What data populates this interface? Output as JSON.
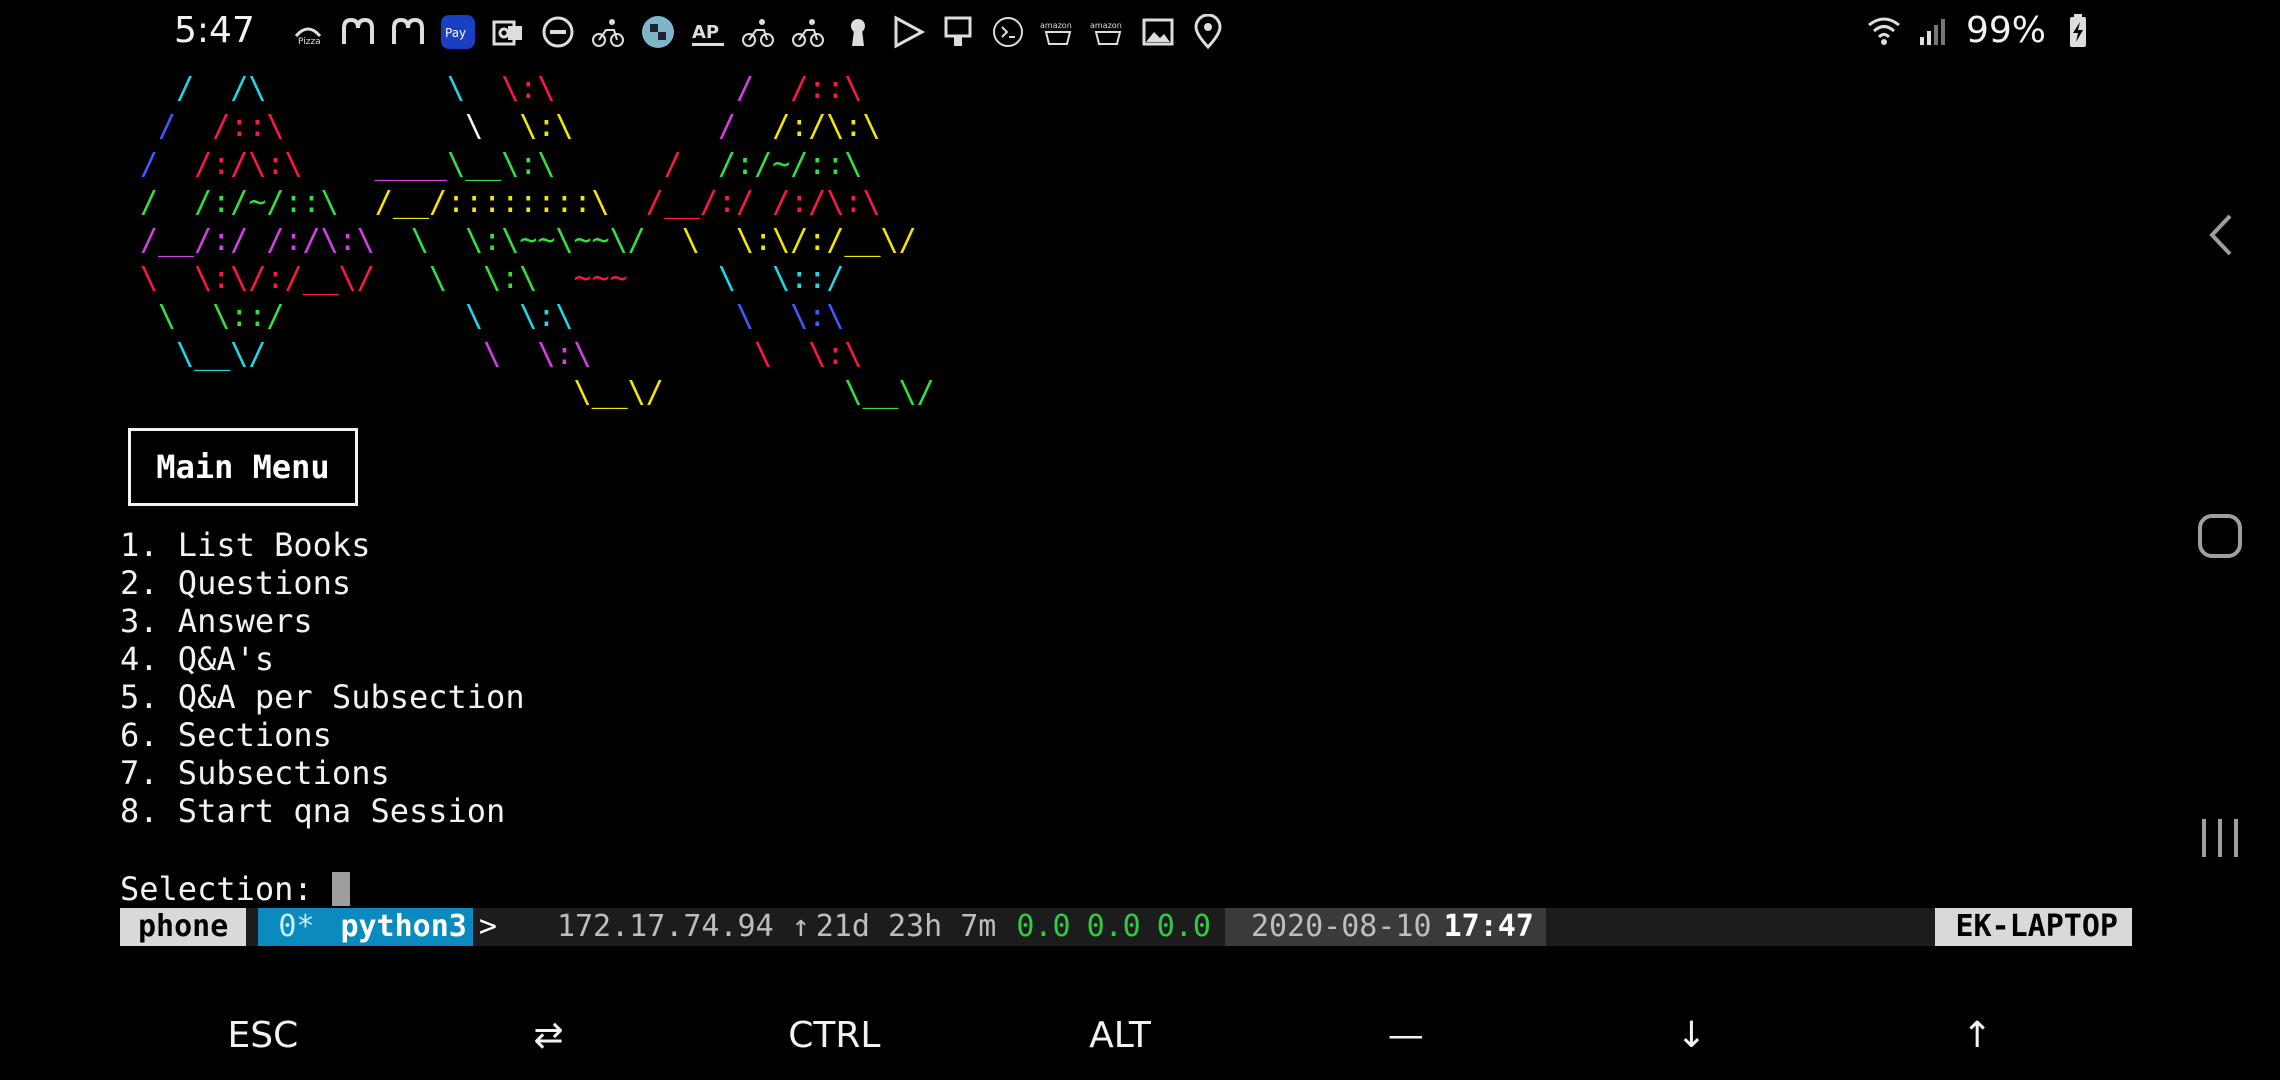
{
  "status_bar": {
    "time": "5:47",
    "icons": [
      "pizza-hut-icon",
      "mcdonalds-icon",
      "mcdonalds-icon",
      "samsung-pay-icon",
      "outlook-icon",
      "do-not-disturb-icon",
      "cycling-icon",
      "chess-icon",
      "ap-news-icon",
      "cycling-icon",
      "cycling-icon",
      "keyhole-icon",
      "play-store-icon",
      "transit-icon",
      "terminal-icon",
      "amazon-icon",
      "amazon-icon",
      "gallery-icon",
      "location-icon"
    ],
    "battery_percent": "99%"
  },
  "ascii_art": [
    [
      {
        "t": "  /  ",
        "c": "c"
      },
      {
        "t": "/\\",
        "c": "c"
      },
      {
        "t": "          \\  ",
        "c": "c"
      },
      {
        "t": "\\:\\",
        "c": "r"
      },
      {
        "t": "          /  ",
        "c": "m"
      },
      {
        "t": "/::\\",
        "c": "r"
      }
    ],
    [
      {
        "t": " /  ",
        "c": "b"
      },
      {
        "t": "/::\\",
        "c": "r"
      },
      {
        "t": "          \\  ",
        "c": "w"
      },
      {
        "t": "\\:\\",
        "c": "y"
      },
      {
        "t": "        /  ",
        "c": "m"
      },
      {
        "t": "/:/\\:\\",
        "c": "y"
      }
    ],
    [
      {
        "t": "/  ",
        "c": "b"
      },
      {
        "t": "/:/\\:\\",
        "c": "r"
      },
      {
        "t": "    ____",
        "c": "m"
      },
      {
        "t": "\\__\\:\\",
        "c": "g"
      },
      {
        "t": "      /  ",
        "c": "r"
      },
      {
        "t": "/:/~/::\\",
        "c": "g"
      }
    ],
    [
      {
        "t": "/  /:/~/::\\",
        "c": "g"
      },
      {
        "t": "  /__/::::::::\\",
        "c": "y"
      },
      {
        "t": "  /__/:/ /:/\\:\\",
        "c": "r"
      }
    ],
    [
      {
        "t": "/__/:/ /:/\\:\\",
        "c": "m"
      },
      {
        "t": "  \\  \\:\\~~\\~~\\/",
        "c": "g"
      },
      {
        "t": "  \\  \\:\\/:/__\\/",
        "c": "y"
      }
    ],
    [
      {
        "t": "\\  \\:\\/:/__\\/",
        "c": "r"
      },
      {
        "t": "   \\  \\:\\  ",
        "c": "g"
      },
      {
        "t": "~~~",
        "c": "r"
      },
      {
        "t": "     \\  \\::/",
        "c": "c"
      }
    ],
    [
      {
        "t": " \\  \\::/",
        "c": "g"
      },
      {
        "t": "          \\  \\:\\",
        "c": "c"
      },
      {
        "t": "         \\  \\:\\",
        "c": "b"
      }
    ],
    [
      {
        "t": "  \\__\\/",
        "c": "c"
      },
      {
        "t": "            \\  \\:\\",
        "c": "m"
      },
      {
        "t": "         \\  \\:\\",
        "c": "r"
      }
    ],
    [
      {
        "t": "                        \\__\\/",
        "c": "y"
      },
      {
        "t": "          \\__\\/",
        "c": "g"
      }
    ]
  ],
  "menu": {
    "title": "Main Menu",
    "items": [
      "1. List Books",
      "2. Questions",
      "3. Answers",
      "4. Q&A's",
      "5. Q&A per Subsection",
      "6. Sections",
      "7. Subsections",
      "8. Start qna Session"
    ],
    "selection_prompt": "Selection: "
  },
  "tmux": {
    "session": "phone",
    "glyph_a": "",
    "glyph_b": "",
    "window_index": "0*",
    "glyph_c": "",
    "window_name": "python3",
    "arrow": ">",
    "ip": "172.17.74.94",
    "glyph_d": "",
    "up_arrow": "↑",
    "uptime": "21d 23h 7m",
    "glyph_e": "",
    "load": [
      "0.0",
      "0.0",
      "0.0"
    ],
    "glyph_f": "",
    "date": "2020-08-10",
    "glyph_g": "",
    "time": "17:47",
    "glyph_h": "",
    "glyph_i": "",
    "host": "EK-LAPTOP"
  },
  "extra_keys": [
    "ESC",
    "⇄",
    "CTRL",
    "ALT",
    "—",
    "↓",
    "↑"
  ],
  "nav_bar": [
    "back-icon",
    "home-icon",
    "recents-icon"
  ]
}
